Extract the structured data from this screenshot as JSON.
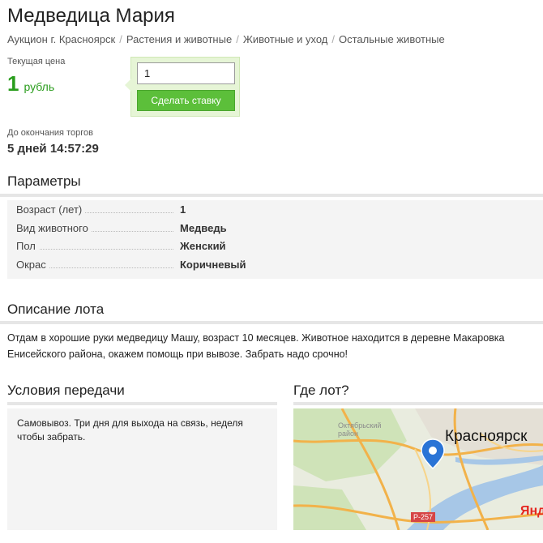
{
  "lot": {
    "title": "Медведица Мария"
  },
  "breadcrumb": [
    "Аукцион г. Красноярск",
    "Растения и животные",
    "Животные и уход",
    "Остальные животные"
  ],
  "price": {
    "label": "Текущая цена",
    "value": "1",
    "unit": "рубль"
  },
  "bid": {
    "input_value": "1",
    "button_label": "Сделать ставку",
    "accent_color": "#5cbf3a"
  },
  "auction_end": {
    "label": "До окончания торгов",
    "value": "5 дней 14:57:29"
  },
  "parameters": {
    "heading": "Параметры",
    "rows": [
      {
        "name": "Возраст (лет)",
        "value": "1"
      },
      {
        "name": "Вид животного",
        "value": "Медведь"
      },
      {
        "name": "Пол",
        "value": "Женский"
      },
      {
        "name": "Окрас",
        "value": "Коричневый"
      }
    ]
  },
  "description": {
    "heading": "Описание лота",
    "text": "Отдам в хорошие руки медведицу Машу, возраст 10 месяцев. Животное находится в деревне Макаровка Енисейского района, окажем помощь при вывозе. Забрать надо срочно!"
  },
  "conditions": {
    "heading": "Условия передачи",
    "text": "Самовывоз. Три дня для выхода на связь, неделя чтобы забрать."
  },
  "location": {
    "heading": "Где лот?",
    "map_city": "Красноярск",
    "map_district": "Октябрьский район",
    "map_road": "Р-257",
    "map_logo": "Янде",
    "pin_icon": "map-pin-icon"
  }
}
